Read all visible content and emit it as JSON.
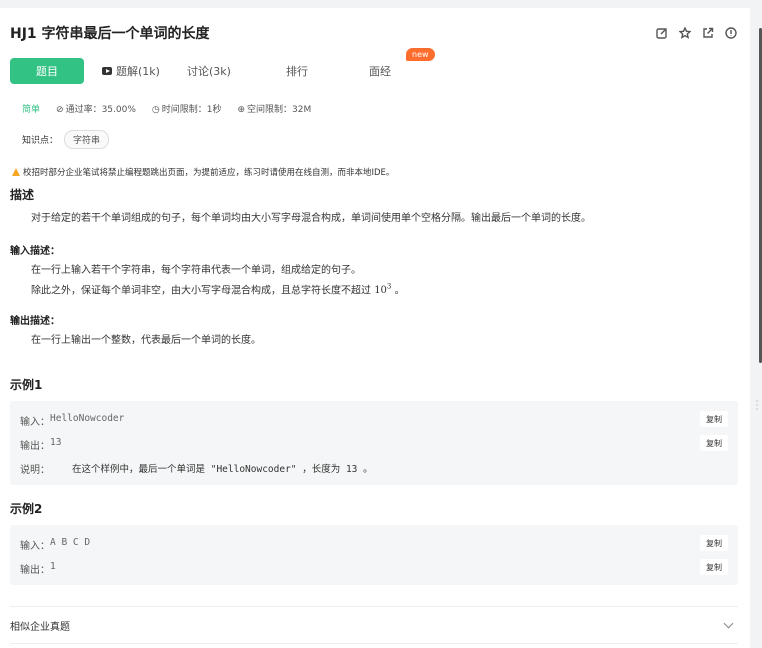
{
  "header": {
    "title": "HJ1  字符串最后一个单词的长度",
    "tools": [
      "edit-icon",
      "star-icon",
      "share-icon",
      "info-icon"
    ]
  },
  "tabs": [
    {
      "label": "题目",
      "active": true
    },
    {
      "label": "题解(1k)",
      "icon": "video-icon"
    },
    {
      "label": "讨论(3k)"
    },
    {
      "label": "排行"
    },
    {
      "label": "面经"
    }
  ],
  "new_badge": "new",
  "meta": {
    "difficulty": "简单",
    "pass_rate": "通过率：35.00%",
    "time_limit": "时间限制：1秒",
    "space_limit": "空间限制：32M"
  },
  "knowledge": {
    "label": "知识点：",
    "tag": "字符串"
  },
  "warning": "校招时部分企业笔试将禁止编程题跳出页面，为提前适应，练习时请使用在线自测，而非本地IDE。",
  "description": {
    "heading": "描述",
    "text": "对于给定的若干个单词组成的句子，每个单词均由大小写字母混合构成，单词间使用单个空格分隔。输出最后一个单词的长度。"
  },
  "input_desc": {
    "heading": "输入描述：",
    "line1": "在一行上输入若干个字符串，每个字符串代表一个单词，组成给定的句子。",
    "line2_prefix": "除此之外，保证每个单词非空，由大小写字母混合构成，且总字符长度不超过 ",
    "line2_math": "10",
    "line2_exp": "3",
    "line2_suffix": " 。"
  },
  "output_desc": {
    "heading": "输出描述：",
    "text": "在一行上输出一个整数，代表最后一个单词的长度。"
  },
  "example1": {
    "heading": "示例1",
    "input_label": "输入：",
    "input_value": "HelloNowcoder",
    "output_label": "输出：",
    "output_value": "13",
    "note_label": "说明：",
    "note_text": "在这个样例中，最后一个单词是 \"HelloNowcoder\" ，长度为 13 。",
    "copy_label": "复制"
  },
  "example2": {
    "heading": "示例2",
    "input_label": "输入：",
    "input_value": "A B C D",
    "output_label": "输出：",
    "output_value": "1",
    "copy_label": "复制"
  },
  "similar": {
    "label": "相似企业真题"
  }
}
